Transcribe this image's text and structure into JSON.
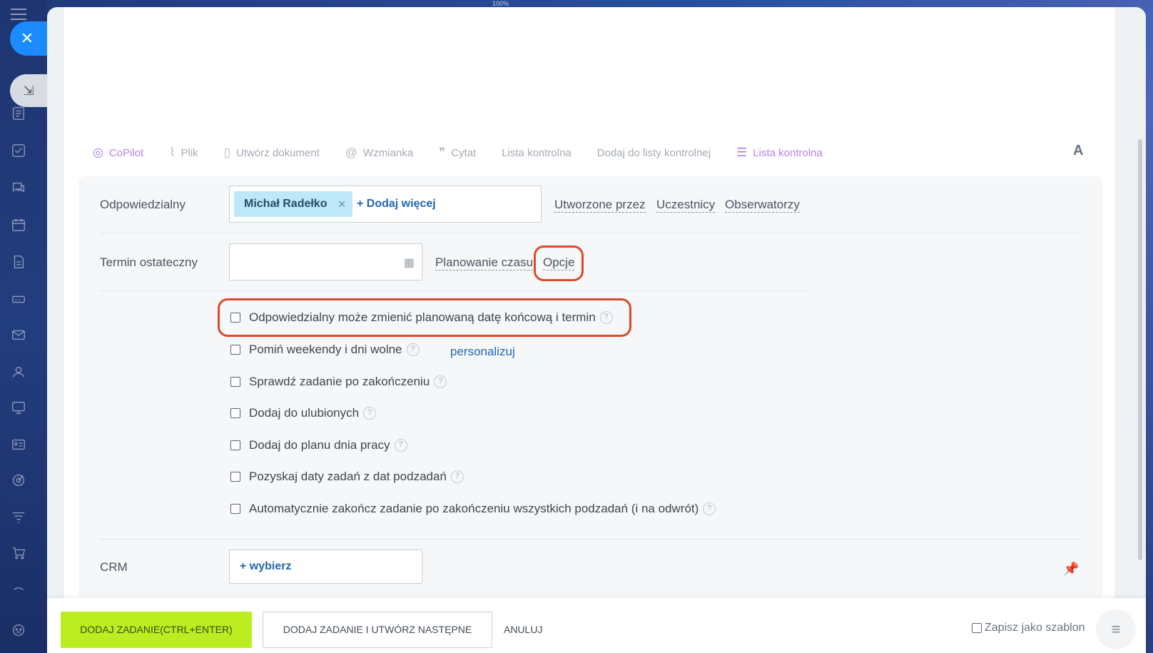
{
  "zoom": "100%",
  "toolbar": {
    "items": [
      {
        "label": "CoPilot",
        "icon": "copilot-icon"
      },
      {
        "label": "Plik",
        "icon": "paperclip-icon"
      },
      {
        "label": "Utwórz dokument",
        "icon": "document-icon"
      },
      {
        "label": "Wzmianka",
        "icon": "at-icon"
      },
      {
        "label": "Cytat",
        "icon": "quote-icon"
      },
      {
        "label": "Lista kontrolna"
      },
      {
        "label": "Dodaj do listy kontrolnej"
      },
      {
        "label": "Lista kontrolna",
        "icon": "checklist-icon"
      }
    ],
    "font_toggle": "A"
  },
  "form": {
    "responsible_label": "Odpowiedzialny",
    "responsible_user": "Michał Radełko",
    "add_more": "+ Dodaj więcej",
    "roles": [
      "Utworzone przez",
      "Uczestnicy",
      "Obserwatorzy"
    ],
    "deadline_label": "Termin ostateczny",
    "planning_link": "Planowanie czasu",
    "options_link": "Opcje",
    "checkboxes": [
      {
        "label": "Odpowiedzialny może zmienić planowaną datę końcową i termin",
        "checked": false
      },
      {
        "label": "Pomiń weekendy i dni wolne",
        "checked": false
      },
      {
        "label": "Sprawdź zadanie po zakończeniu",
        "checked": false
      },
      {
        "label": "Dodaj do ulubionych",
        "checked": false
      },
      {
        "label": "Dodaj do planu dnia pracy",
        "checked": false
      },
      {
        "label": "Pozyskaj daty zadań z dat podzadań",
        "checked": false
      },
      {
        "label": "Automatycznie zakończ zadanie po zakończeniu wszystkich podzadań (i na odwrót)",
        "checked": false
      }
    ],
    "personalize_link": "personalizuj",
    "crm_label": "CRM",
    "crm_select": "+ wybierz"
  },
  "footer": {
    "add_task": "DODAJ ZADANIE(CTRL+ENTER)",
    "add_and_next": "DODAJ ZADANIE I UTWÓRZ NASTĘPNE",
    "cancel": "ANULUJ",
    "save_template": "Zapisz jako szablon"
  },
  "colors": {
    "accent_green": "#bbed21",
    "link_blue": "#2067b0",
    "highlight_red": "#d94b2a",
    "close_blue": "#1a8cff"
  }
}
